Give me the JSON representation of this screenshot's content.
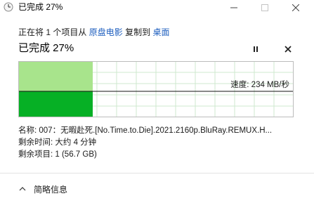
{
  "window": {
    "title": "已完成 27%",
    "icon": "copy-progress-clock-icon"
  },
  "status": {
    "prefix": "正在将",
    "count": "1",
    "mid": "个项目从",
    "source": "原盘电影",
    "action": "复制到",
    "destination": "桌面"
  },
  "progress": {
    "title": "已完成 27%",
    "fraction": 0.27,
    "speed_label": "速度: 234 MB/秒"
  },
  "details": {
    "name_label": "名称: ",
    "name_value": "007：无暇赴死.[No.Time.to.Die].2021.2160p.BluRay.REMUX.H...",
    "time_label": "剩余时间: ",
    "time_value": "大约 4 分钟",
    "items_label": "剩余项目: ",
    "items_value": "1 (56.7 GB)"
  },
  "footer": {
    "toggle_label": "简略信息"
  },
  "colors": {
    "graph_fill": "#06b025",
    "graph_done_bg": "#a8e48c",
    "graph_grid": "#cfe9cf",
    "link": "#1f5fbf"
  }
}
